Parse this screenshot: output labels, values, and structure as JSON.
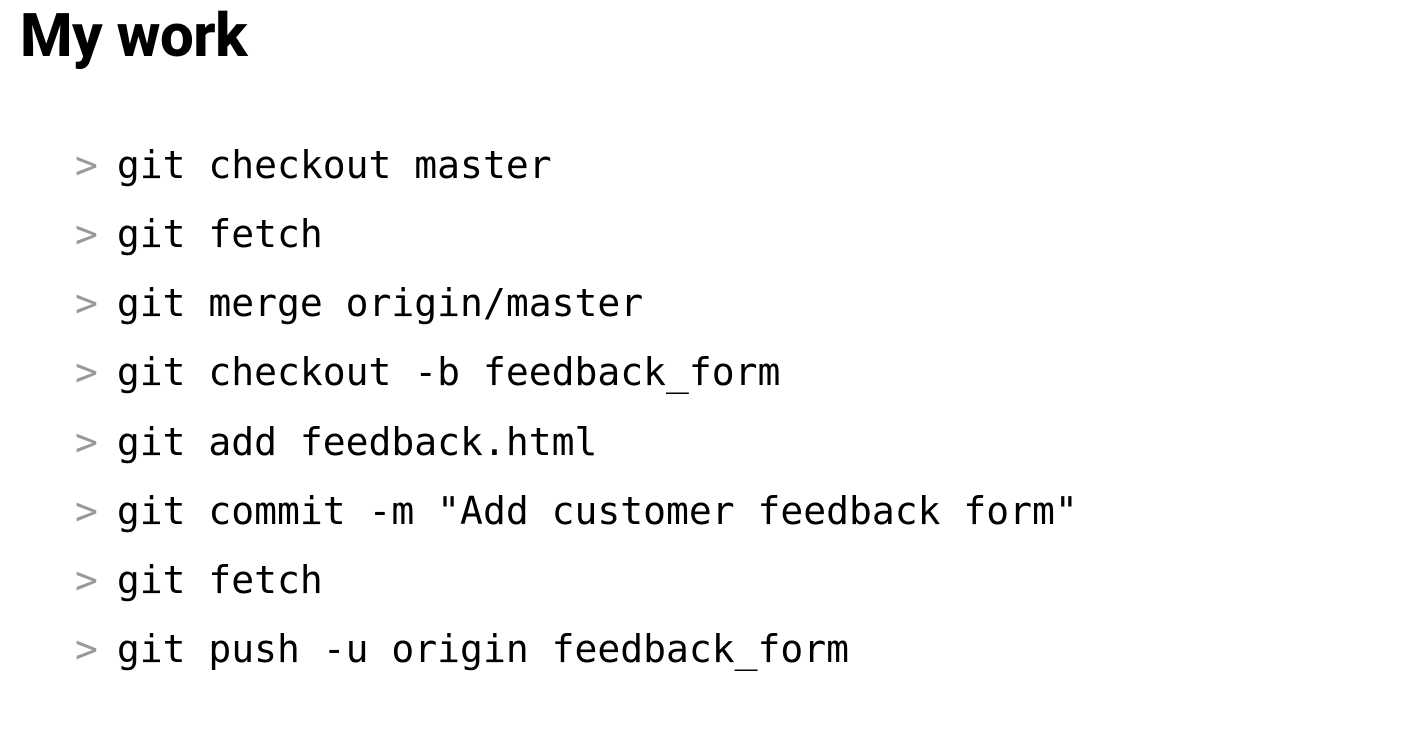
{
  "heading": "My work",
  "prompt_symbol": ">",
  "commands": [
    "git checkout master",
    "git fetch",
    "git merge origin/master",
    "git checkout -b feedback_form",
    "git add feedback.html",
    "git commit -m \"Add customer feedback form\"",
    "git fetch",
    "git push -u origin feedback_form"
  ]
}
